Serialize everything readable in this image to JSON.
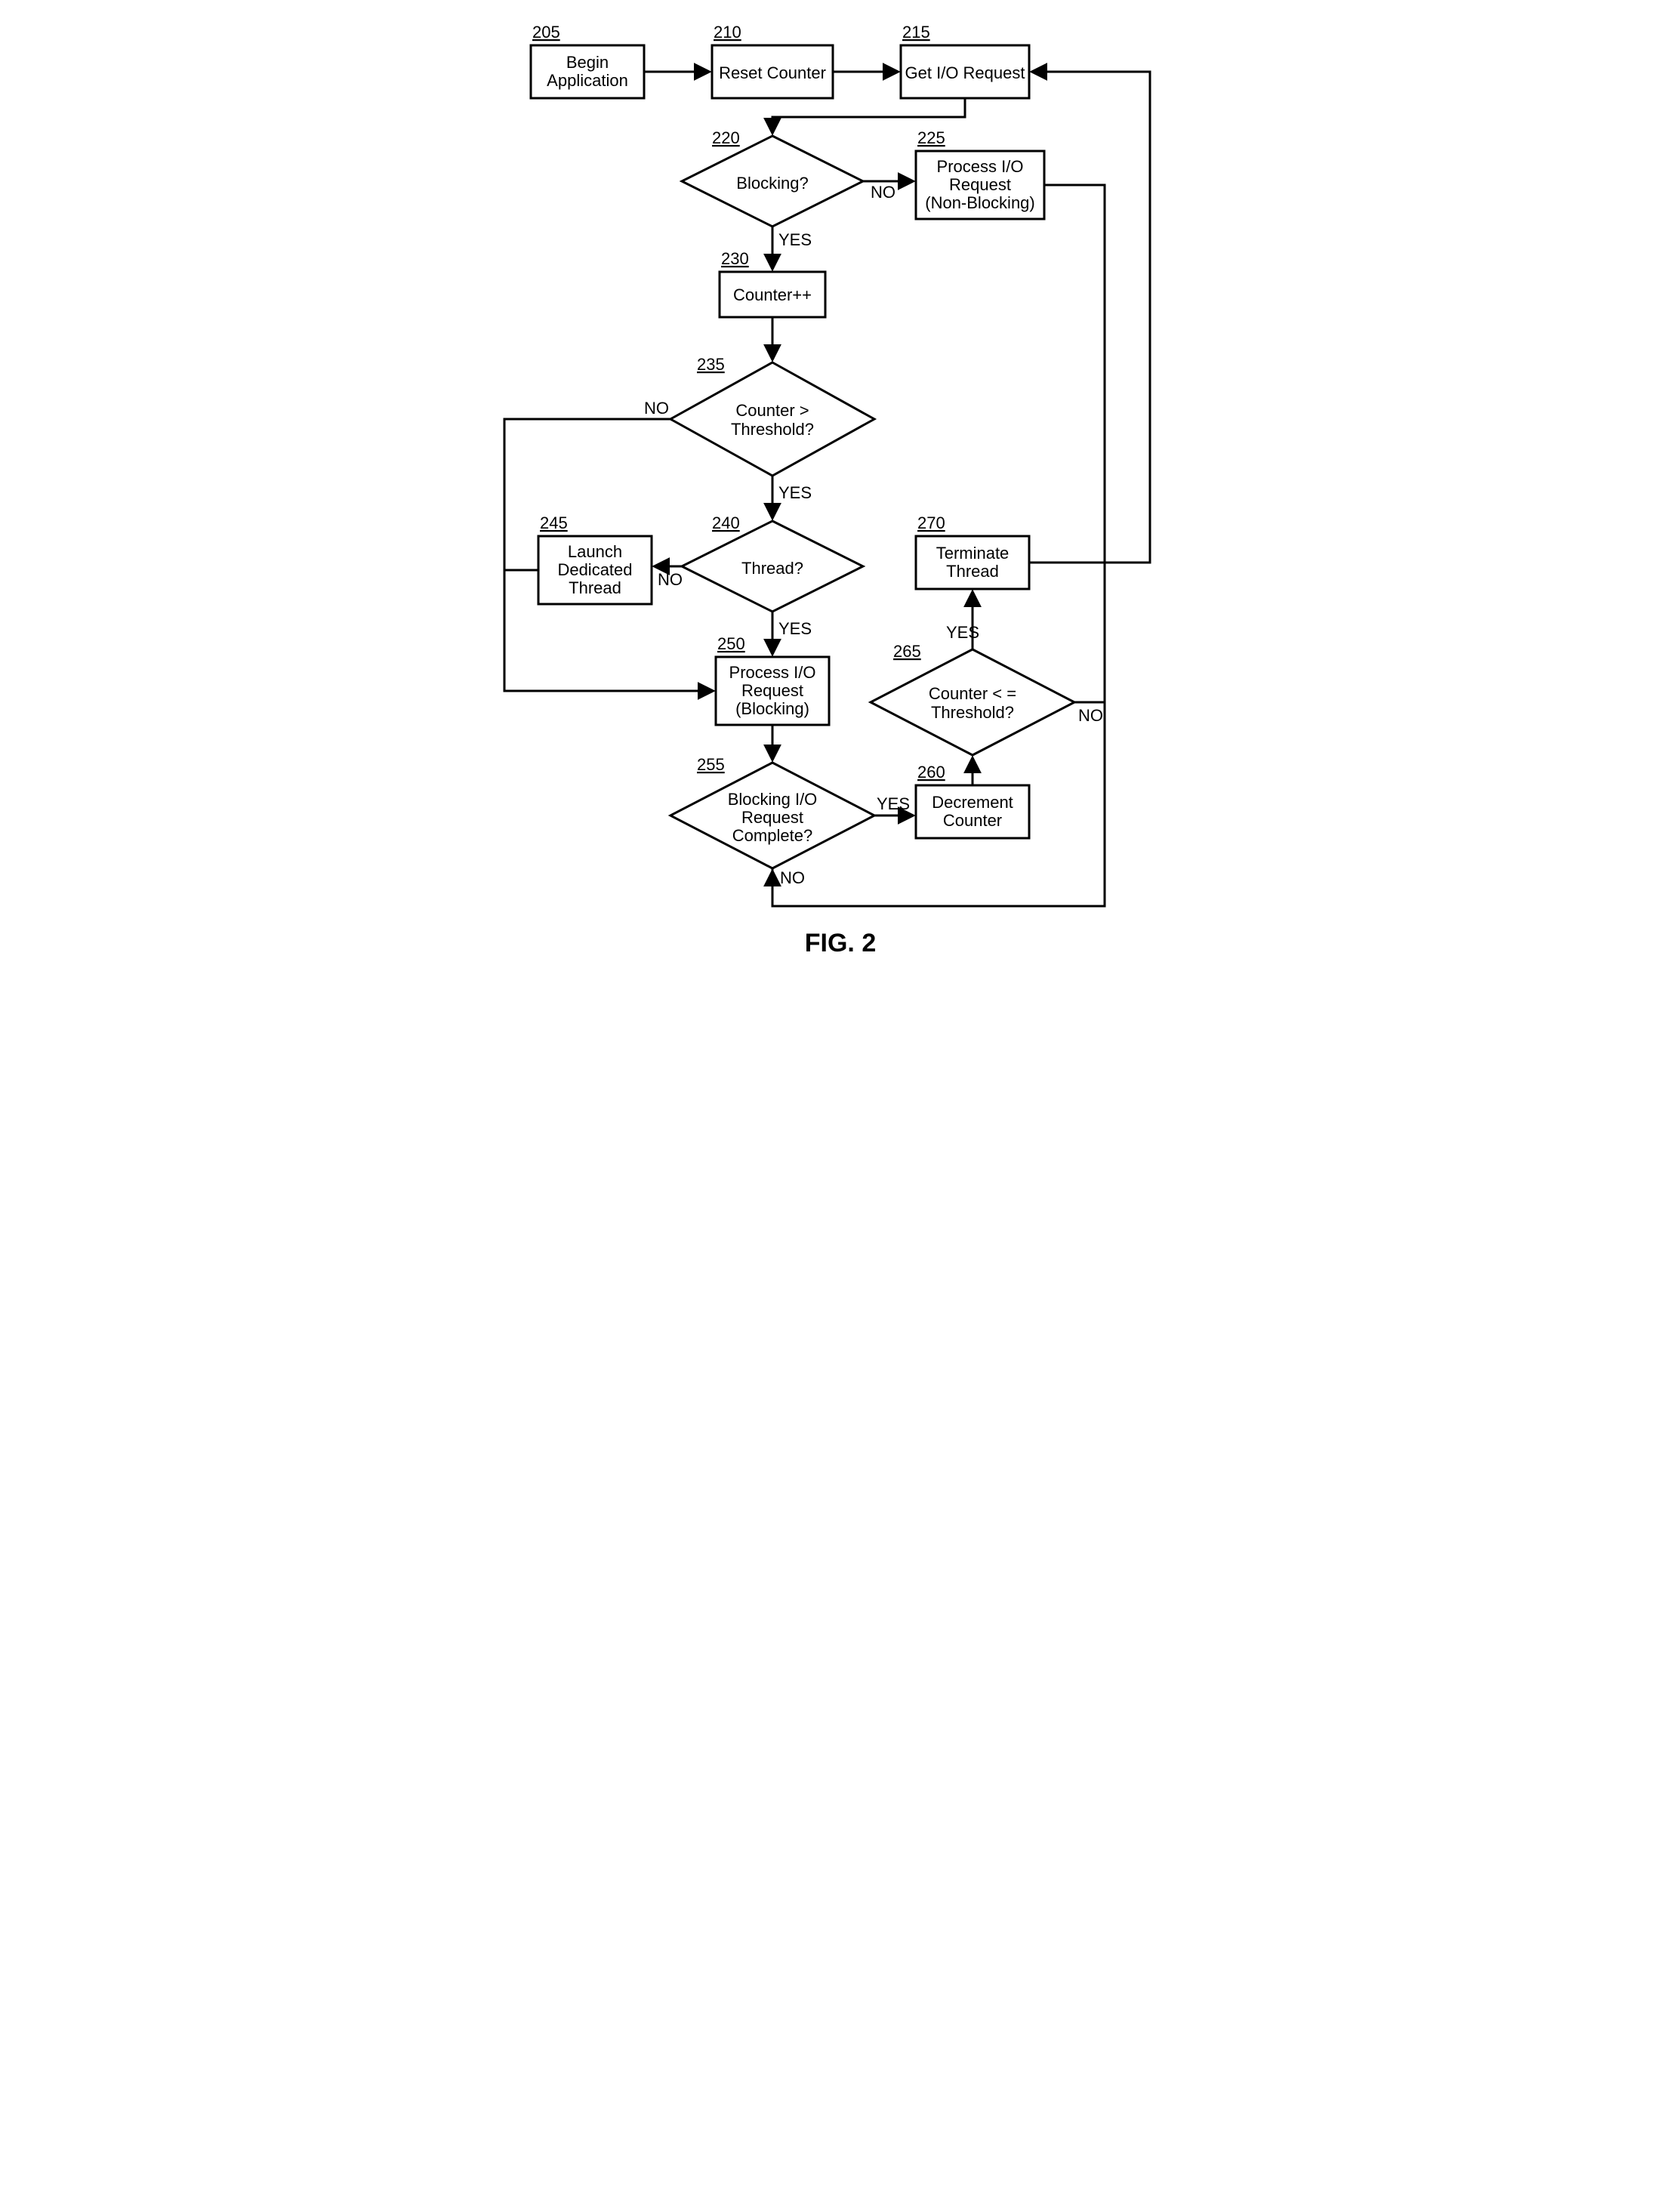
{
  "figure_label": "FIG. 2",
  "nodes": {
    "205": {
      "num": "205",
      "l1": "Begin",
      "l2": "Application"
    },
    "210": {
      "num": "210",
      "l1": "Reset Counter"
    },
    "215": {
      "num": "215",
      "l1": "Get I/O Request"
    },
    "220": {
      "num": "220",
      "l1": "Blocking?"
    },
    "225": {
      "num": "225",
      "l1": "Process I/O",
      "l2": "Request",
      "l3": "(Non-Blocking)"
    },
    "230": {
      "num": "230",
      "l1": "Counter++"
    },
    "235": {
      "num": "235",
      "l1": "Counter >",
      "l2": "Threshold?"
    },
    "240": {
      "num": "240",
      "l1": "Thread?"
    },
    "245": {
      "num": "245",
      "l1": "Launch",
      "l2": "Dedicated",
      "l3": "Thread"
    },
    "250": {
      "num": "250",
      "l1": "Process I/O",
      "l2": "Request",
      "l3": "(Blocking)"
    },
    "255": {
      "num": "255",
      "l1": "Blocking I/O",
      "l2": "Request",
      "l3": "Complete?"
    },
    "260": {
      "num": "260",
      "l1": "Decrement",
      "l2": "Counter"
    },
    "265": {
      "num": "265",
      "l1": "Counter < =",
      "l2": "Threshold?"
    },
    "270": {
      "num": "270",
      "l1": "Terminate",
      "l2": "Thread"
    }
  },
  "edges": {
    "yes": "YES",
    "no": "NO"
  }
}
